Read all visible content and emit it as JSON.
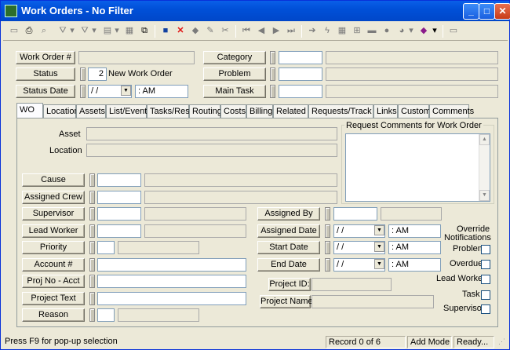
{
  "window": {
    "title": "Work Orders - No Filter",
    "minimize_glyph": "_",
    "maximize_glyph": "□",
    "close_glyph": "✕"
  },
  "toolbar": {
    "icons": [
      "new-icon",
      "print-icon",
      "print-preview-icon",
      "filter-icon",
      "filter-clear-icon",
      "list-view-icon",
      "form-view-icon",
      "copy-icon",
      "save-icon",
      "delete-icon",
      "erase-icon",
      "edit-icon",
      "cut-icon",
      "first-record-icon",
      "prev-record-icon",
      "next-record-icon",
      "last-record-icon",
      "go-icon",
      "lightning-icon",
      "grid-icon",
      "tree-icon",
      "link-icon",
      "eye-icon",
      "globe-icon",
      "book-icon",
      "notes-icon"
    ]
  },
  "header": {
    "work_order_label": "Work Order #",
    "work_order_value": "",
    "status_label": "Status",
    "status_code": "2",
    "status_text": "New Work Order",
    "status_date_label": "Status Date",
    "status_date_value": "/ /",
    "status_time_value": ":  AM",
    "category_label": "Category",
    "problem_label": "Problem",
    "main_task_label": "Main Task"
  },
  "tabs": [
    "WO",
    "Location",
    "Assets",
    "List/Events",
    "Tasks/Res",
    "Routing",
    "Costs",
    "Billing",
    "Related",
    "Requests/Track",
    "Links",
    "Custom",
    "Comments"
  ],
  "wo": {
    "asset_label": "Asset",
    "location_label": "Location",
    "request_comments_label": "Request Comments for Work Order",
    "cause_label": "Cause",
    "assigned_crew_label": "Assigned Crew",
    "supervisor_label": "Supervisor",
    "lead_worker_label": "Lead Worker",
    "priority_label": "Priority",
    "account_label": "Account #",
    "proj_no_label": "Proj No - Acct",
    "project_text_label": "Project Text",
    "reason_label": "Reason",
    "assigned_by_label": "Assigned By",
    "assigned_date_label": "Assigned Date",
    "start_date_label": "Start Date",
    "end_date_label": "End Date",
    "date_blank": "/ /",
    "time_blank": ":  AM",
    "project_id_label": "Project ID:",
    "project_name_label": "Project Name:",
    "override_title": "Override\nNotifications",
    "override_line1": "Override",
    "override_line2": "Notifications",
    "chk_problem": "Problem",
    "chk_overdue": "Overdue",
    "chk_lead_worker": "Lead Worker",
    "chk_task": "Task",
    "chk_supervisor": "Supervisor"
  },
  "statusbar": {
    "hint": "Press F9 for pop-up selection",
    "record": "Record 0 of 6",
    "mode": "Add Mode",
    "state": "Ready..."
  }
}
